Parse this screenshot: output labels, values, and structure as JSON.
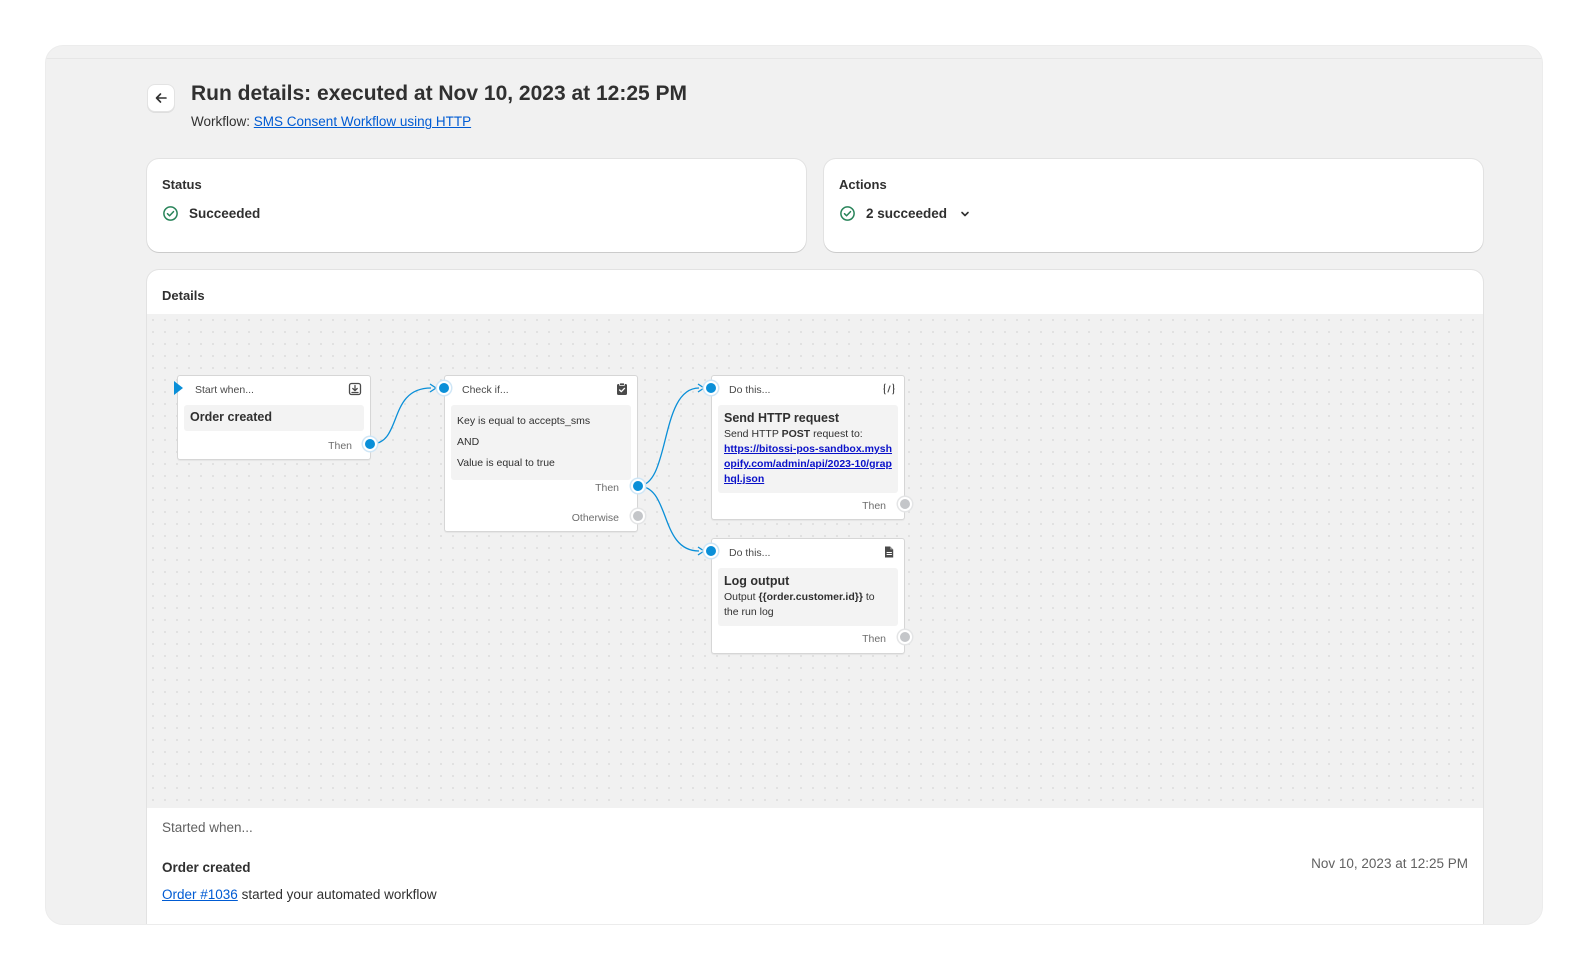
{
  "header": {
    "title": "Run details: executed at Nov 10, 2023 at 12:25 PM",
    "workflow_label": "Workflow:",
    "workflow_link": "SMS Consent Workflow using HTTP"
  },
  "status_card": {
    "heading": "Status",
    "value": "Succeeded"
  },
  "actions_card": {
    "heading": "Actions",
    "value": "2 succeeded"
  },
  "details": {
    "heading": "Details",
    "nodes": {
      "trigger": {
        "head": "Start when...",
        "title": "Order created",
        "out": "Then"
      },
      "condition": {
        "head": "Check if...",
        "line1": "Key is equal to accepts_sms",
        "line2": "AND",
        "line3": "Value is equal to true",
        "out_then": "Then",
        "out_otherwise": "Otherwise"
      },
      "http": {
        "head": "Do this...",
        "title": "Send HTTP request",
        "desc_prefix": "Send HTTP ",
        "method": "POST",
        "desc_suffix": " request to:",
        "url": "https://bitossi-pos-sandbox.myshopify.com/admin/api/2023-10/graphql.json",
        "out": "Then"
      },
      "log": {
        "head": "Do this...",
        "title": "Log output",
        "desc_prefix": "Output ",
        "var": "{{order.customer.id}}",
        "desc_suffix": " to the run log",
        "out": "Then"
      }
    },
    "started_label": "Started when...",
    "trigger_name": "Order created",
    "trigger_time": "Nov 10, 2023 at 12:25 PM",
    "order_link": "Order #1036",
    "trigger_desc": " started your automated workflow"
  },
  "colors": {
    "accent": "#0a8fd8",
    "link": "#005bd3",
    "success": "#29845a"
  },
  "icons": [
    "back-arrow-icon",
    "check-circle-icon",
    "chevron-down-icon",
    "download-box-icon",
    "clipboard-check-icon",
    "code-braces-icon",
    "document-icon"
  ]
}
